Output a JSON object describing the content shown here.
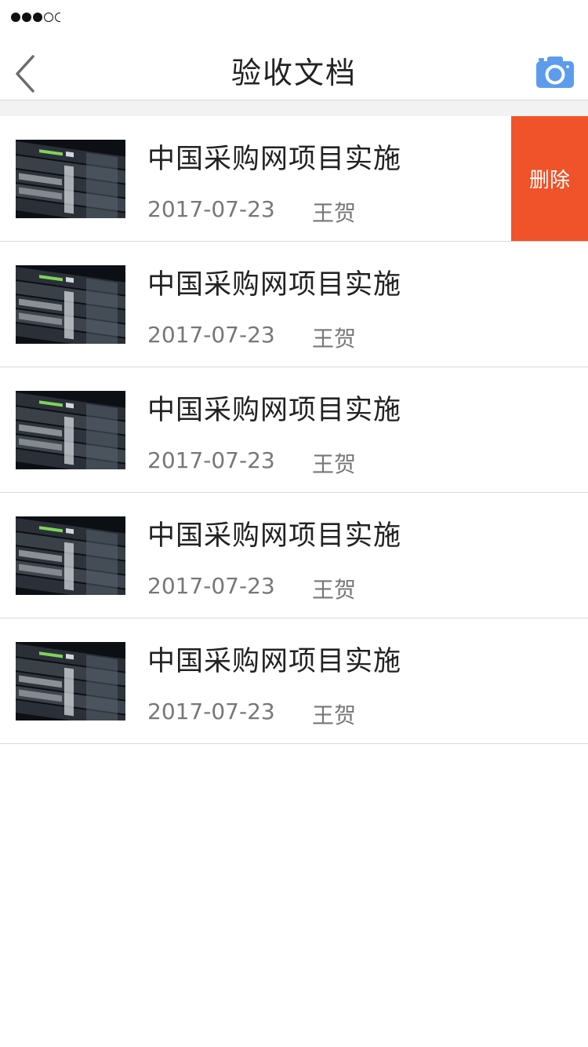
{
  "status_bar": {
    "signal_bars_filled": 3,
    "signal_bars_total": 5
  },
  "nav": {
    "title": "验收文档",
    "back_icon": "chevron-left-icon",
    "camera_icon": "camera-icon",
    "accent_color": "#5d9cec"
  },
  "list": {
    "delete_label": "删除",
    "delete_color": "#f0532a",
    "items": [
      {
        "title": "中国采购网项目实施",
        "date": "2017-07-23",
        "author": "王贺",
        "thumbnail": "server-rack-image"
      },
      {
        "title": "中国采购网项目实施",
        "date": "2017-07-23",
        "author": "王贺",
        "thumbnail": "server-rack-image"
      },
      {
        "title": "中国采购网项目实施",
        "date": "2017-07-23",
        "author": "王贺",
        "thumbnail": "server-rack-image"
      },
      {
        "title": "中国采购网项目实施",
        "date": "2017-07-23",
        "author": "王贺",
        "thumbnail": "server-rack-image"
      },
      {
        "title": "中国采购网项目实施",
        "date": "2017-07-23",
        "author": "王贺",
        "thumbnail": "server-rack-image"
      }
    ]
  }
}
